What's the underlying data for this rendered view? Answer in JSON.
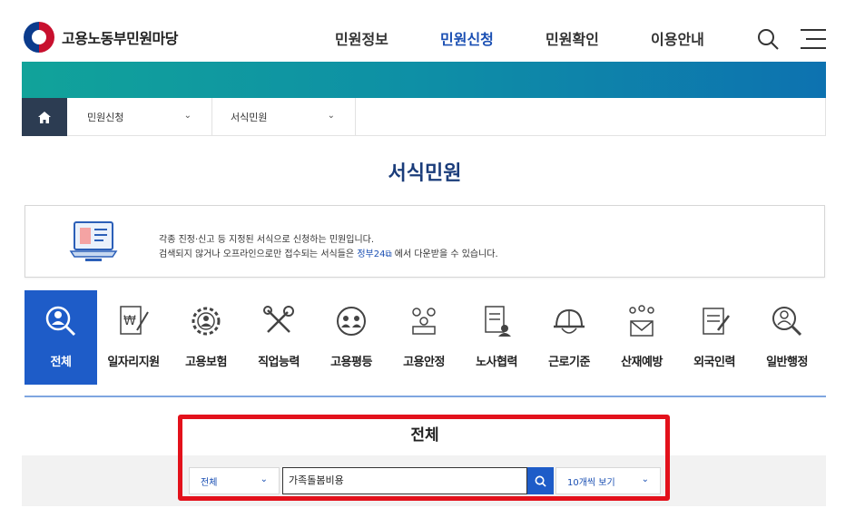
{
  "header": {
    "logo_text": "고용노동부민원마당",
    "nav": [
      "민원정보",
      "민원신청",
      "민원확인",
      "이용안내"
    ],
    "active_nav": "민원신청",
    "colors": {
      "accent": "#1a4fb3",
      "banner_start": "#11a39a",
      "banner_end": "#0d72b0"
    }
  },
  "breadcrumb": {
    "home_icon": "home-icon",
    "items": [
      {
        "label": "민원신청"
      },
      {
        "label": "서식민원"
      }
    ]
  },
  "page": {
    "title": "서식민원",
    "info_line1": "각종 진정·신고 등 지정된 서식으로 신청하는 민원입니다.",
    "info_line2_pre": "검색되지 않거나 오프라인으로만 접수되는 서식들은",
    "info_link": "정부24",
    "info_line2_post": "에서 다운받을 수 있습니다."
  },
  "categories": [
    {
      "label": "전체",
      "icon": "search-person-icon",
      "active": true
    },
    {
      "label": "일자리지원",
      "icon": "won-document-icon"
    },
    {
      "label": "고용보험",
      "icon": "gear-person-icon"
    },
    {
      "label": "직업능력",
      "icon": "tools-icon"
    },
    {
      "label": "고용평등",
      "icon": "people-circle-icon"
    },
    {
      "label": "고용안정",
      "icon": "group-icon"
    },
    {
      "label": "노사협력",
      "icon": "document-person-icon"
    },
    {
      "label": "근로기준",
      "icon": "helmet-icon"
    },
    {
      "label": "산재예방",
      "icon": "people-mail-icon"
    },
    {
      "label": "외국인력",
      "icon": "document-pen-icon"
    },
    {
      "label": "일반행정",
      "icon": "search-person-icon"
    }
  ],
  "search": {
    "section_title": "전체",
    "scope_select": "전체",
    "query": "가족돌봄비용",
    "page_size_select": "10개씩 보기"
  }
}
